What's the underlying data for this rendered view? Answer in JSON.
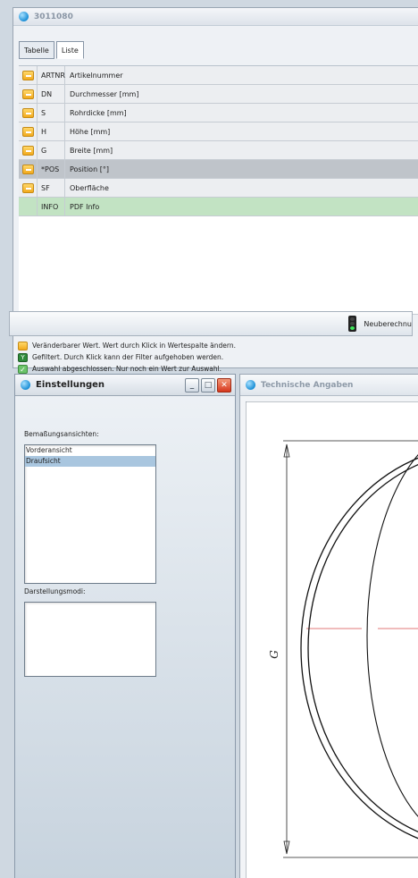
{
  "window": {
    "title": "3011080"
  },
  "tabs": [
    {
      "label": "Tabelle"
    },
    {
      "label": "Liste"
    }
  ],
  "rows": [
    {
      "code": "ARTNR",
      "name": "Artikelnummer"
    },
    {
      "code": "DN",
      "name": "Durchmesser [mm]"
    },
    {
      "code": "S",
      "name": "Rohrdicke [mm]"
    },
    {
      "code": "H",
      "name": "Höhe [mm]"
    },
    {
      "code": "G",
      "name": "Breite [mm]"
    },
    {
      "code": "*POS",
      "name": "Position [°]"
    },
    {
      "code": "SF",
      "name": "Oberfläche"
    },
    {
      "code": "INFO",
      "name": "PDF Info"
    }
  ],
  "recalc": {
    "label": "Neuberechnu"
  },
  "legend": [
    {
      "icon": "edit-icon",
      "text": "Veränderbarer Wert. Wert durch Klick in Wertespalte ändern."
    },
    {
      "icon": "filter-icon",
      "text": "Gefiltert. Durch Klick kann der Filter aufgehoben werden."
    },
    {
      "icon": "check-icon",
      "text": "Auswahl abgeschlossen. Nur noch ein Wert zur Auswahl."
    }
  ],
  "settings": {
    "title": "Einstellungen",
    "bemassung_label": "Bemaßungsansichten:",
    "views": [
      "Vorderansicht",
      "Draufsicht"
    ],
    "selected_view": "Draufsicht",
    "darstellung_label": "Darstellungsmodi:"
  },
  "tech": {
    "title": "Technische Angaben",
    "dimension_label": "G"
  },
  "colors": {
    "accent": "#1b8fd6",
    "info_row": "#c2e3c3",
    "selected_row": "#bfc4ca",
    "centerline": "#e07a7a"
  }
}
